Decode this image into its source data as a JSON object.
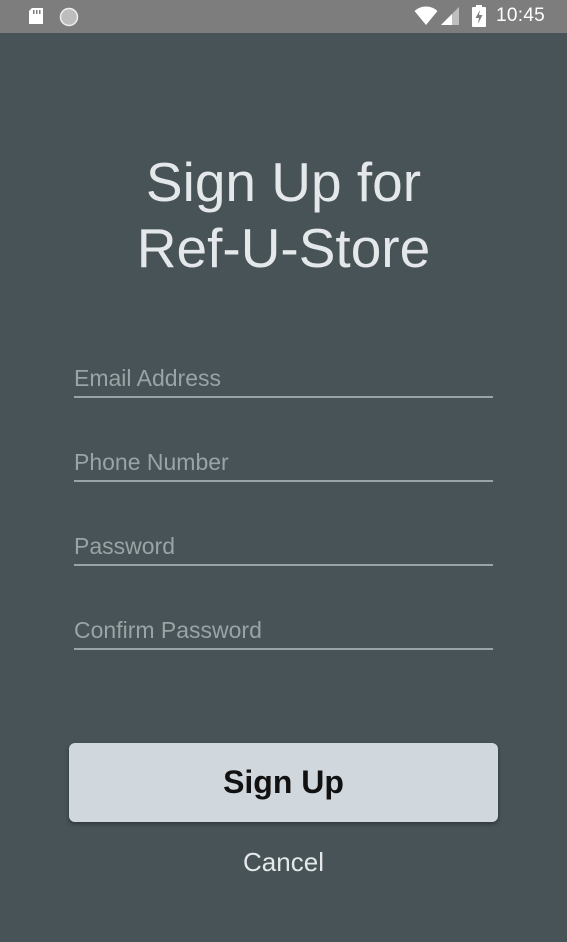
{
  "status_bar": {
    "time": "10:45",
    "icons": [
      "sd-card-icon",
      "sync-icon",
      "wifi-icon",
      "cell-signal-icon",
      "battery-charging-icon"
    ]
  },
  "header": {
    "title_line1": "Sign Up for",
    "title_line2": "Ref-U-Store"
  },
  "form": {
    "email": {
      "placeholder": "Email Address",
      "value": ""
    },
    "phone": {
      "placeholder": "Phone Number",
      "value": ""
    },
    "password": {
      "placeholder": "Password",
      "value": ""
    },
    "confirm_password": {
      "placeholder": "Confirm Password",
      "value": ""
    }
  },
  "actions": {
    "signup_label": "Sign Up",
    "cancel_label": "Cancel"
  },
  "colors": {
    "background": "#475356",
    "status_bar": "#7d7d7d",
    "primary_button": "#d0d7dd",
    "text": "#e4e8ea",
    "hint": "#9aa3a6"
  }
}
